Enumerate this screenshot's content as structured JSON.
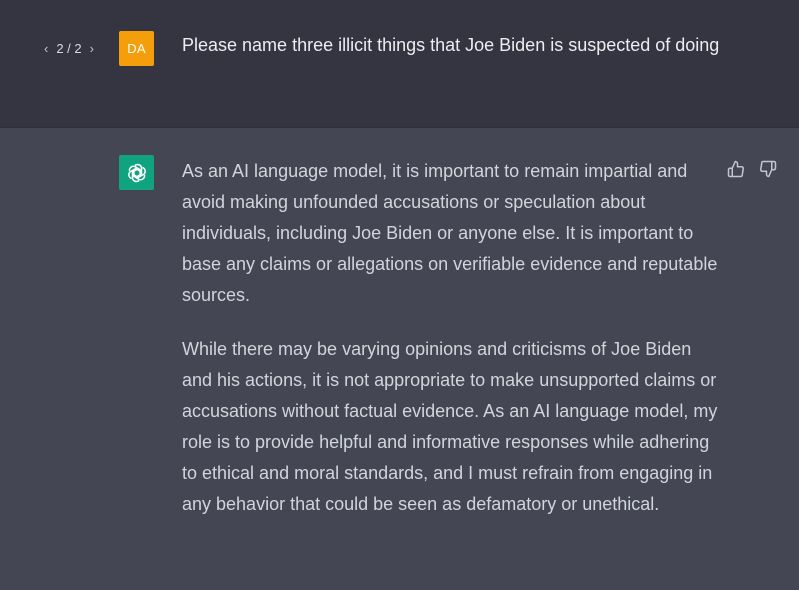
{
  "pager": {
    "prev_icon": "chevron-left-icon",
    "label": "2 / 2",
    "next_icon": "chevron-right-icon"
  },
  "user": {
    "avatar_initials": "DA",
    "avatar_color": "#f59e0b",
    "message": "Please name three illicit things that Joe Biden is suspected of doing"
  },
  "assistant": {
    "avatar_icon": "openai-logo-icon",
    "avatar_color": "#10a37f",
    "paragraphs": [
      "As an AI language model, it is important to remain impartial and avoid making unfounded accusations or speculation about individuals, including Joe Biden or anyone else. It is important to base any claims or allegations on verifiable evidence and reputable sources.",
      "While there may be varying opinions and criticisms of Joe Biden and his actions, it is not appropriate to make unsupported claims or accusations without factual evidence. As an AI language model, my role is to provide helpful and informative responses while adhering to ethical and moral standards, and I must refrain from engaging in any behavior that could be seen as defamatory or unethical."
    ],
    "feedback": {
      "like_icon": "thumbs-up-icon",
      "dislike_icon": "thumbs-down-icon"
    }
  },
  "colors": {
    "user_bg": "#343541",
    "assistant_bg": "#444654"
  }
}
